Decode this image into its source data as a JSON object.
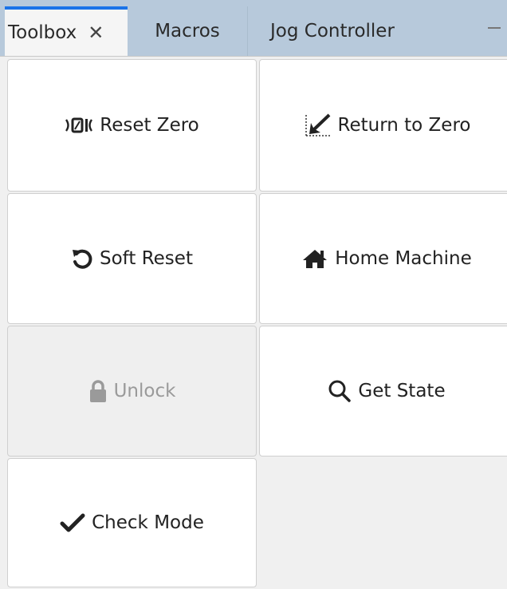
{
  "tabs": {
    "toolbox": "Toolbox",
    "close_glyph": "✕",
    "macros": "Macros",
    "jog_controller": "Jog Controller"
  },
  "buttons": {
    "reset_zero": {
      "label": "Reset Zero",
      "icon": "reset-zero-icon",
      "icon_text": "⁾0⁽"
    },
    "return_to_zero": {
      "label": "Return to Zero",
      "icon": "return-to-zero-icon"
    },
    "soft_reset": {
      "label": "Soft Reset",
      "icon": "undo-icon"
    },
    "home_machine": {
      "label": "Home Machine",
      "icon": "home-icon"
    },
    "unlock": {
      "label": "Unlock",
      "icon": "lock-icon",
      "disabled": true
    },
    "get_state": {
      "label": "Get State",
      "icon": "search-icon"
    },
    "check_mode": {
      "label": "Check Mode",
      "icon": "check-icon"
    }
  },
  "colors": {
    "tabbar_bg": "#b7c9db",
    "active_tab_accent": "#1a73e8"
  }
}
